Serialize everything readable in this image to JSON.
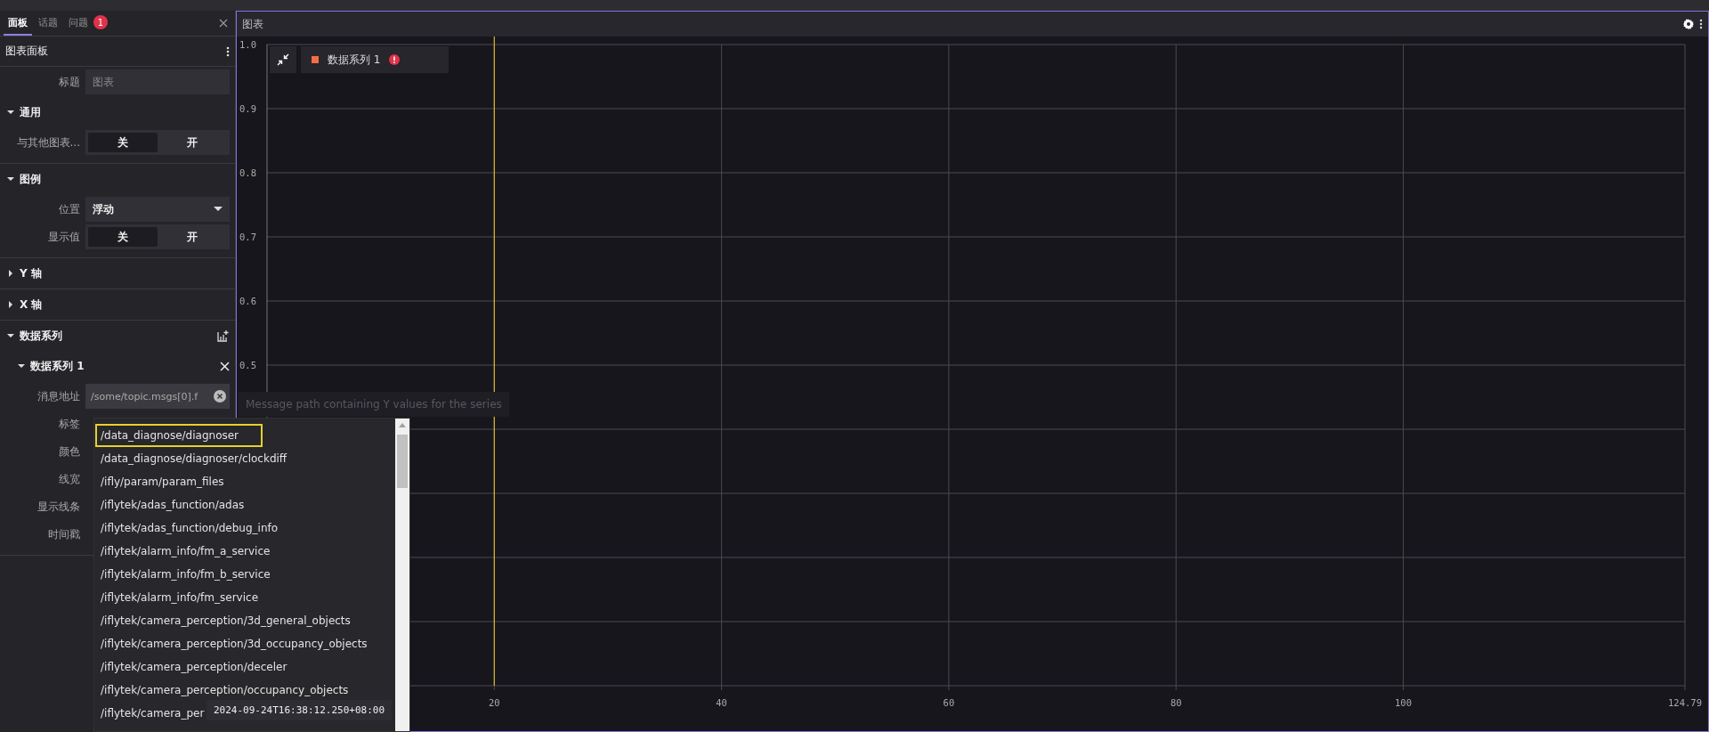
{
  "sidebar": {
    "tabs": [
      {
        "label": "面板",
        "selected": true
      },
      {
        "label": "话题",
        "selected": false
      },
      {
        "label": "问题",
        "selected": false,
        "badge": "1"
      }
    ],
    "panel_title": "图表面板",
    "settings": [
      {
        "kind": "text",
        "label": "标题",
        "placeholder": "图表"
      },
      {
        "kind": "section",
        "label": "通用",
        "expanded": true,
        "children": [
          {
            "kind": "toggle",
            "label": "与其他图表...",
            "options": [
              {
                "label": "关",
                "selected": true
              },
              {
                "label": "开",
                "selected": false
              }
            ]
          }
        ]
      },
      {
        "kind": "section",
        "label": "图例",
        "expanded": true,
        "children": [
          {
            "kind": "select",
            "label": "位置",
            "value": "浮动"
          },
          {
            "kind": "toggle",
            "label": "显示值",
            "options": [
              {
                "label": "关",
                "selected": true
              },
              {
                "label": "开",
                "selected": false
              }
            ]
          }
        ]
      },
      {
        "kind": "section",
        "label": "Y 轴",
        "expanded": false
      },
      {
        "kind": "section",
        "label": "X 轴",
        "expanded": false
      },
      {
        "kind": "section",
        "label": "数据系列",
        "expanded": true,
        "addable": true,
        "children": [
          {
            "kind": "subsection",
            "label": "数据系列 1",
            "expanded": true,
            "removable": true,
            "children": [
              {
                "kind": "path",
                "label": "消息地址",
                "value": "/some/topic.msgs[0].f"
              },
              {
                "kind": "label",
                "label": "标签"
              },
              {
                "kind": "label",
                "label": "颜色"
              },
              {
                "kind": "label",
                "label": "线宽"
              },
              {
                "kind": "label",
                "label": "显示线条"
              },
              {
                "kind": "label",
                "label": "时间戳"
              }
            ]
          }
        ]
      }
    ]
  },
  "chart_panel": {
    "title": "图表",
    "legend": [
      {
        "name": "数据系列 1",
        "color": "#f26d44",
        "error": true
      }
    ],
    "chart_data": {
      "type": "line",
      "xlim": [
        0,
        124.79
      ],
      "ylim": [
        0,
        1
      ],
      "xticks": [
        20,
        40,
        60,
        80,
        100,
        {
          "value": 124.79,
          "label": "124.79"
        }
      ],
      "yticks": [
        {
          "value": 0.5,
          "label": "0.5"
        },
        {
          "value": 0.6,
          "label": "0.6"
        },
        {
          "value": 0.7,
          "label": "0.7"
        },
        {
          "value": 0.8,
          "label": "0.8"
        },
        {
          "value": 0.9,
          "label": "0.9"
        },
        {
          "value": 1,
          "label": "1.0"
        }
      ],
      "grid": true,
      "ref_lines": [
        {
          "axis": "x",
          "value": 20,
          "color": "#d9b62a"
        }
      ]
    }
  },
  "path_hint": "Message path containing Y values for the series",
  "suggestions": [
    {
      "label": "/data_diagnose/diagnoser",
      "selected": true
    },
    {
      "label": "/data_diagnose/diagnoser/clockdiff",
      "selected": false
    },
    {
      "label": "/ifly/param/param_files",
      "selected": false
    },
    {
      "label": "/iflytek/adas_function/adas",
      "selected": false
    },
    {
      "label": "/iflytek/adas_function/debug_info",
      "selected": false
    },
    {
      "label": "/iflytek/alarm_info/fm_a_service",
      "selected": false
    },
    {
      "label": "/iflytek/alarm_info/fm_b_service",
      "selected": false
    },
    {
      "label": "/iflytek/alarm_info/fm_service",
      "selected": false
    },
    {
      "label": "/iflytek/camera_perception/3d_general_objects",
      "selected": false
    },
    {
      "label": "/iflytek/camera_perception/3d_occupancy_objects",
      "selected": false
    },
    {
      "label": "/iflytek/camera_perception/deceler",
      "selected": false
    },
    {
      "label": "/iflytek/camera_perception/occupancy_objects",
      "selected": false
    },
    {
      "label": "/iflytek/camera_per",
      "selected": false
    }
  ],
  "hover_time": "2024-09-24T16:38:12.250+08:00"
}
